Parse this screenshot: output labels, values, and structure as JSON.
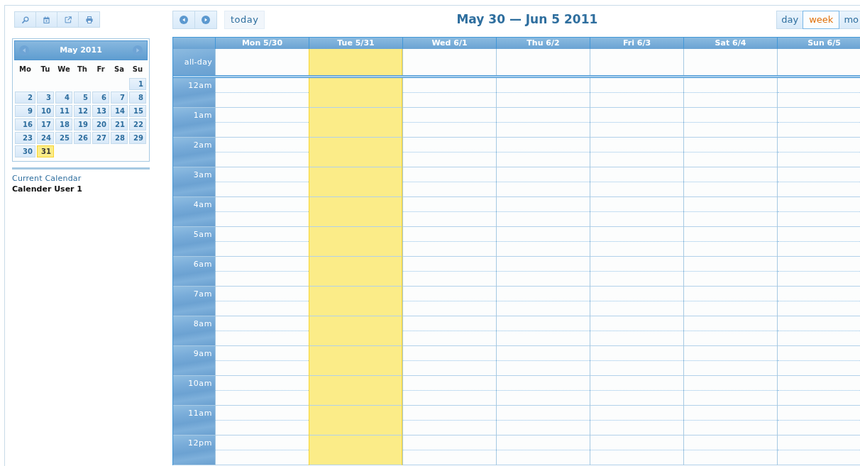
{
  "sidebar": {
    "mini_calendar": {
      "title": "May 2011",
      "weekdays": [
        "Mo",
        "Tu",
        "We",
        "Th",
        "Fr",
        "Sa",
        "Su"
      ],
      "weeks": [
        [
          {
            "label": "1",
            "selected": false
          }
        ],
        [
          {
            "label": "2",
            "selected": false
          },
          {
            "label": "3",
            "selected": false
          },
          {
            "label": "4",
            "selected": false
          },
          {
            "label": "5",
            "selected": false
          },
          {
            "label": "6",
            "selected": false
          },
          {
            "label": "7",
            "selected": false
          },
          {
            "label": "8",
            "selected": false
          }
        ],
        [
          {
            "label": "9",
            "selected": false
          },
          {
            "label": "10",
            "selected": false
          },
          {
            "label": "11",
            "selected": false
          },
          {
            "label": "12",
            "selected": false
          },
          {
            "label": "13",
            "selected": false
          },
          {
            "label": "14",
            "selected": false
          },
          {
            "label": "15",
            "selected": false
          }
        ],
        [
          {
            "label": "16",
            "selected": false
          },
          {
            "label": "17",
            "selected": false
          },
          {
            "label": "18",
            "selected": false
          },
          {
            "label": "19",
            "selected": false
          },
          {
            "label": "20",
            "selected": false
          },
          {
            "label": "21",
            "selected": false
          },
          {
            "label": "22",
            "selected": false
          }
        ],
        [
          {
            "label": "23",
            "selected": false
          },
          {
            "label": "24",
            "selected": false
          },
          {
            "label": "25",
            "selected": false
          },
          {
            "label": "26",
            "selected": false
          },
          {
            "label": "27",
            "selected": false
          },
          {
            "label": "28",
            "selected": false
          },
          {
            "label": "29",
            "selected": false
          }
        ],
        [
          {
            "label": "30",
            "selected": false
          },
          {
            "label": "31",
            "selected": true
          }
        ]
      ]
    },
    "current_calendar": {
      "heading": "Current Calendar",
      "name": "Calender User 1"
    }
  },
  "header": {
    "today_button": "today",
    "title": "May 30 — Jun 5 2011",
    "views": [
      {
        "label": "day",
        "selected": false
      },
      {
        "label": "week",
        "selected": true
      },
      {
        "label": "mo",
        "selected": false
      }
    ]
  },
  "grid": {
    "columns": [
      {
        "label": "Mon 5/30",
        "today": false
      },
      {
        "label": "Tue 5/31",
        "today": true
      },
      {
        "label": "Wed 6/1",
        "today": false
      },
      {
        "label": "Thu 6/2",
        "today": false
      },
      {
        "label": "Fri 6/3",
        "today": false
      },
      {
        "label": "Sat 6/4",
        "today": false
      },
      {
        "label": "Sun 6/5",
        "today": false
      }
    ],
    "all_day_label": "all-day",
    "hours": [
      "12am",
      "1am",
      "2am",
      "3am",
      "4am",
      "5am",
      "6am",
      "7am",
      "8am",
      "9am",
      "10am",
      "11am",
      "12pm"
    ]
  }
}
